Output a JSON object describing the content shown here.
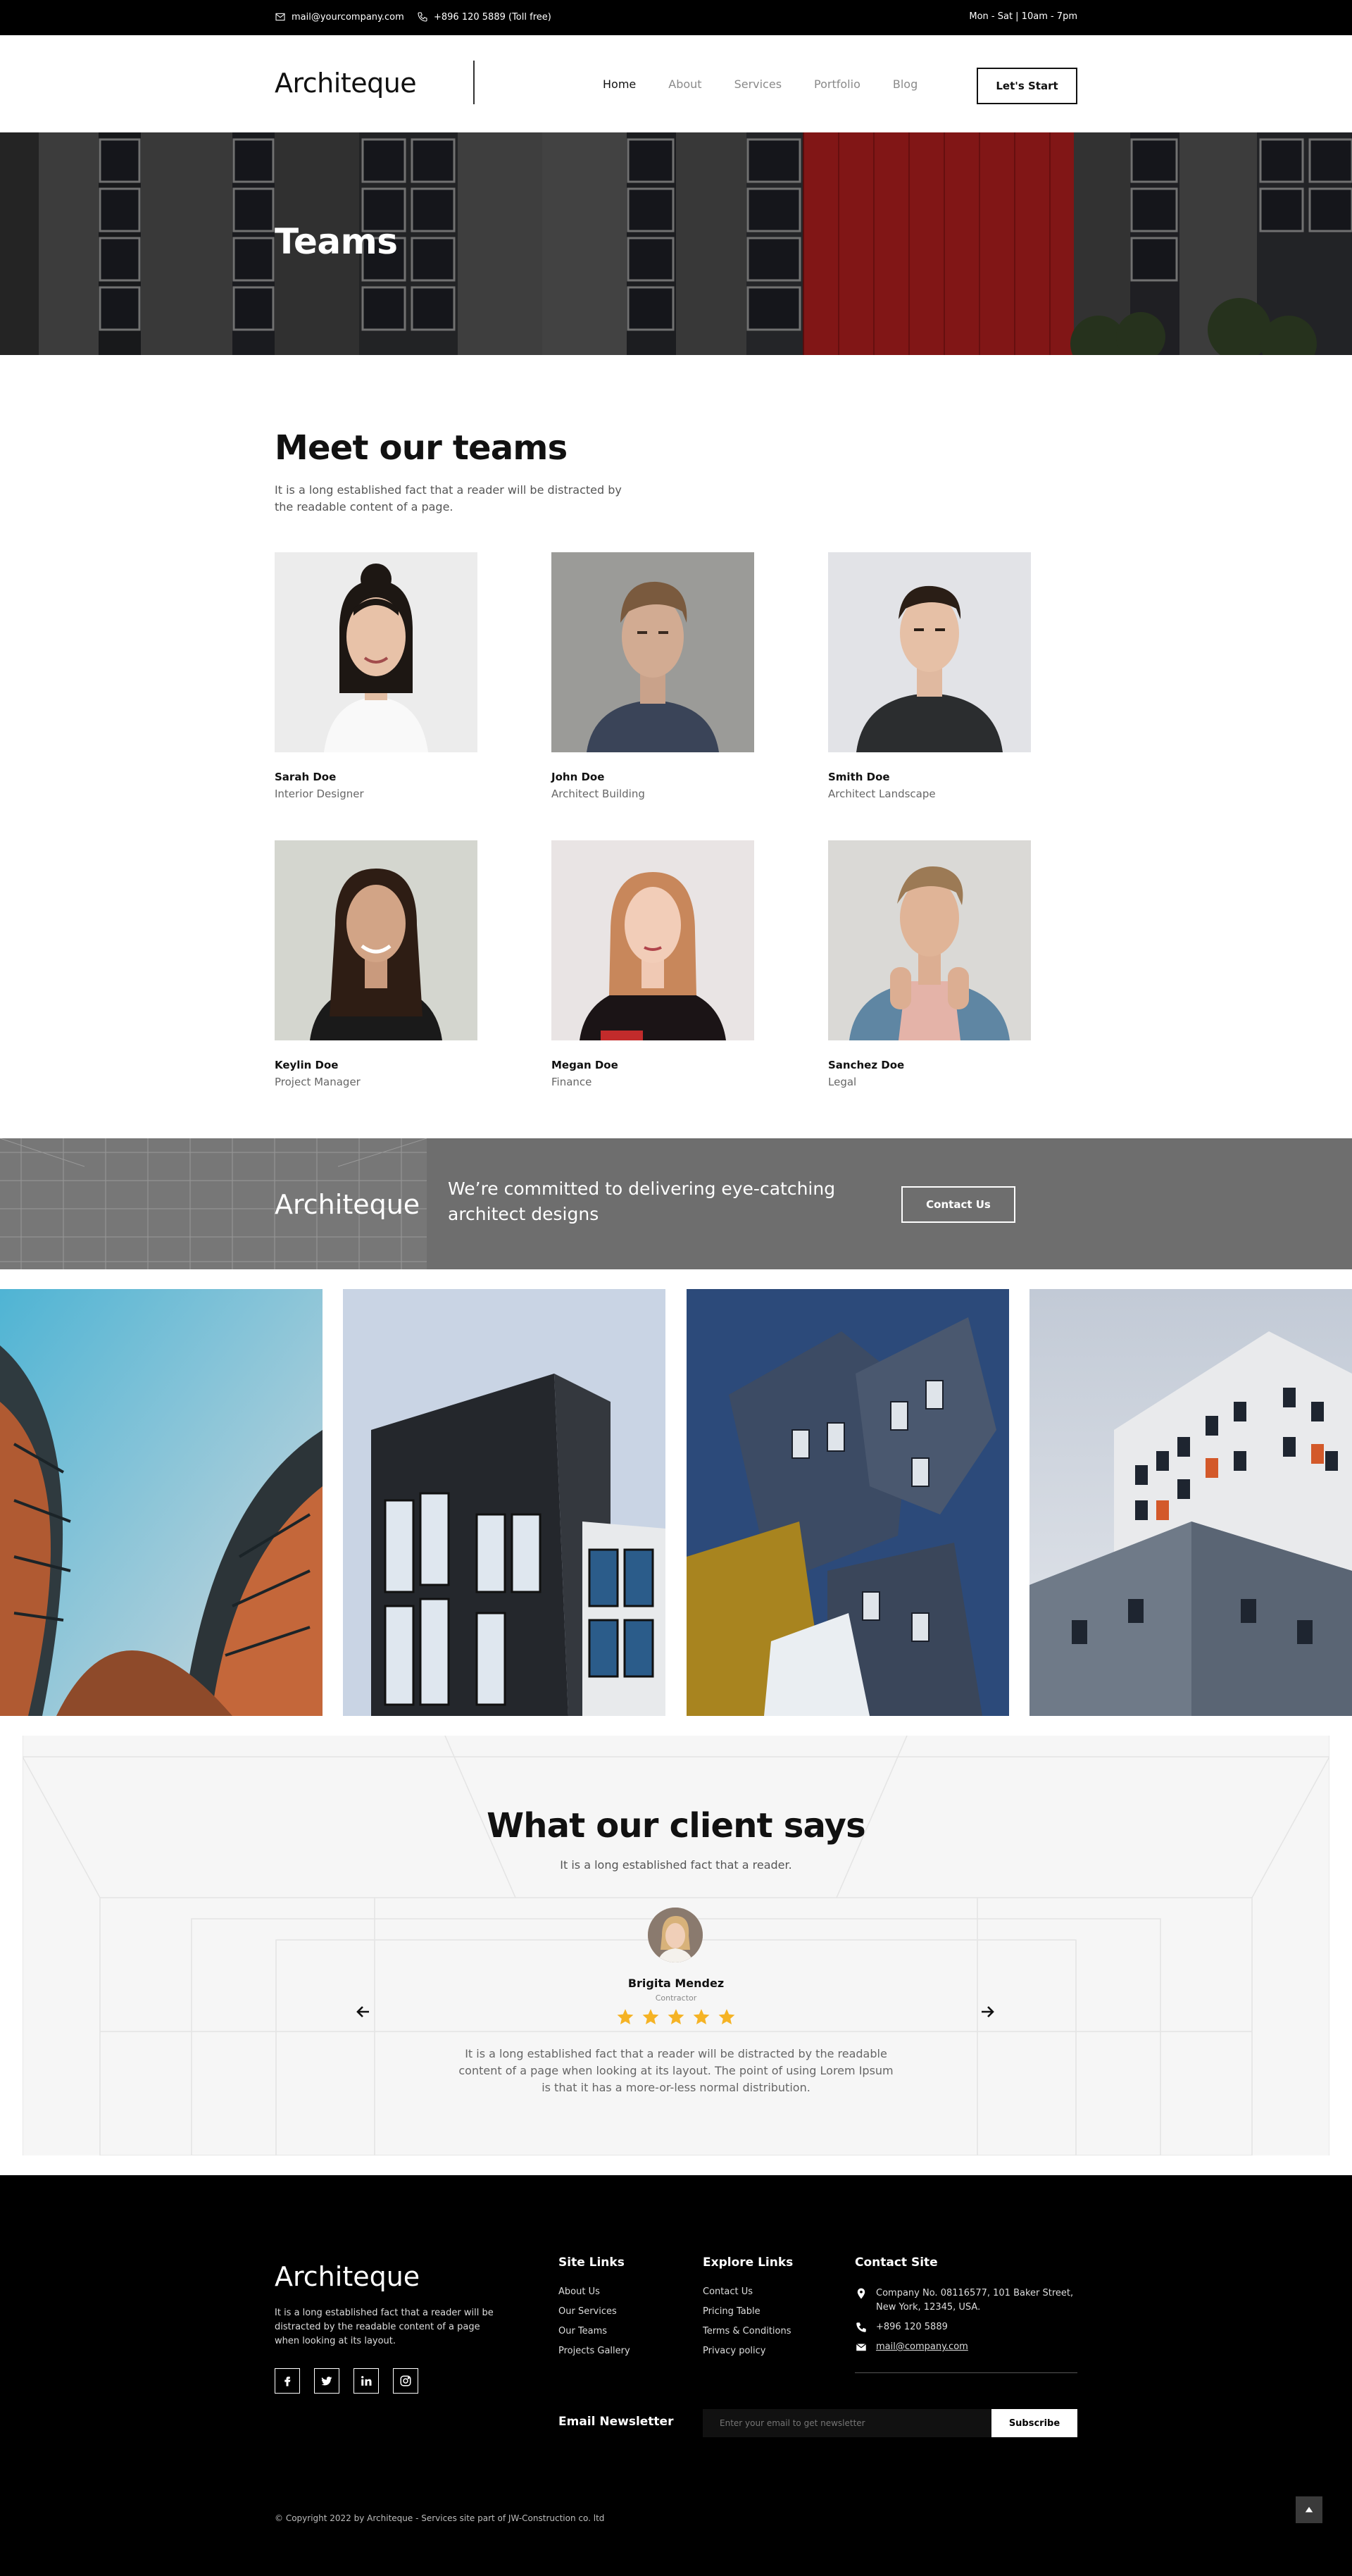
{
  "topbar": {
    "email": "mail@yourcompany.com",
    "phone": "+896 120 5889 (Toll free)",
    "hours": "Mon - Sat | 10am - 7pm"
  },
  "header": {
    "logo": "Architeque",
    "nav": [
      "Home",
      "About",
      "Services",
      "Portfolio",
      "Blog"
    ],
    "active_nav": "Home",
    "cta": "Let's Start"
  },
  "hero": {
    "title": "Teams"
  },
  "team": {
    "title": "Meet our teams",
    "subtitle": "It is a long established fact that a reader will be distracted by the readable content of a page.",
    "members": [
      {
        "name": "Sarah Doe",
        "role": "Interior Designer"
      },
      {
        "name": "John Doe",
        "role": "Architect Building"
      },
      {
        "name": "Smith Doe",
        "role": "Architect Landscape"
      },
      {
        "name": "Keylin Doe",
        "role": "Project Manager"
      },
      {
        "name": "Megan Doe",
        "role": "Finance"
      },
      {
        "name": "Sanchez Doe",
        "role": "Legal"
      }
    ]
  },
  "cta_band": {
    "logo": "Architeque",
    "text": "We’re committed to delivering eye-catching architect designs",
    "button": "Contact Us"
  },
  "testimonial": {
    "title": "What our client says",
    "subtitle": "It is a long established fact that a reader.",
    "name": "Brigita Mendez",
    "role": "Contractor",
    "rating": 5,
    "quote": "It is a long established fact that a reader will be distracted by the readable content of a page when looking at its layout. The point of using Lorem Ipsum is that it has a more-or-less normal distribution."
  },
  "footer": {
    "logo": "Architeque",
    "about": "It is a long established fact that a reader will be distracted by the readable content of a page when looking at its layout.",
    "site_links": {
      "title": "Site Links",
      "items": [
        "About Us",
        "Our Services",
        "Our Teams",
        "Projects Gallery"
      ]
    },
    "explore_links": {
      "title": "Explore Links",
      "items": [
        "Contact Us",
        "Pricing Table",
        "Terms & Conditions",
        "Privacy policy"
      ]
    },
    "contact": {
      "title": "Contact Site",
      "address": "Company No. 08116577, 101 Baker Street, New York, 12345, USA.",
      "phone": "+896 120 5889",
      "email": "mail@company.com"
    },
    "newsletter": {
      "label": "Email Newsletter",
      "placeholder": "Enter your email to get newsletter",
      "button": "Subscribe"
    },
    "copyright": "© Copyright 2022 by Architeque - Services site part of JW-Construction co. ltd"
  },
  "colors": {
    "black": "#000000",
    "cta_grey": "#6e6e6e",
    "star_yellow": "#f5b325",
    "hero_red": "#9e1b1b"
  }
}
